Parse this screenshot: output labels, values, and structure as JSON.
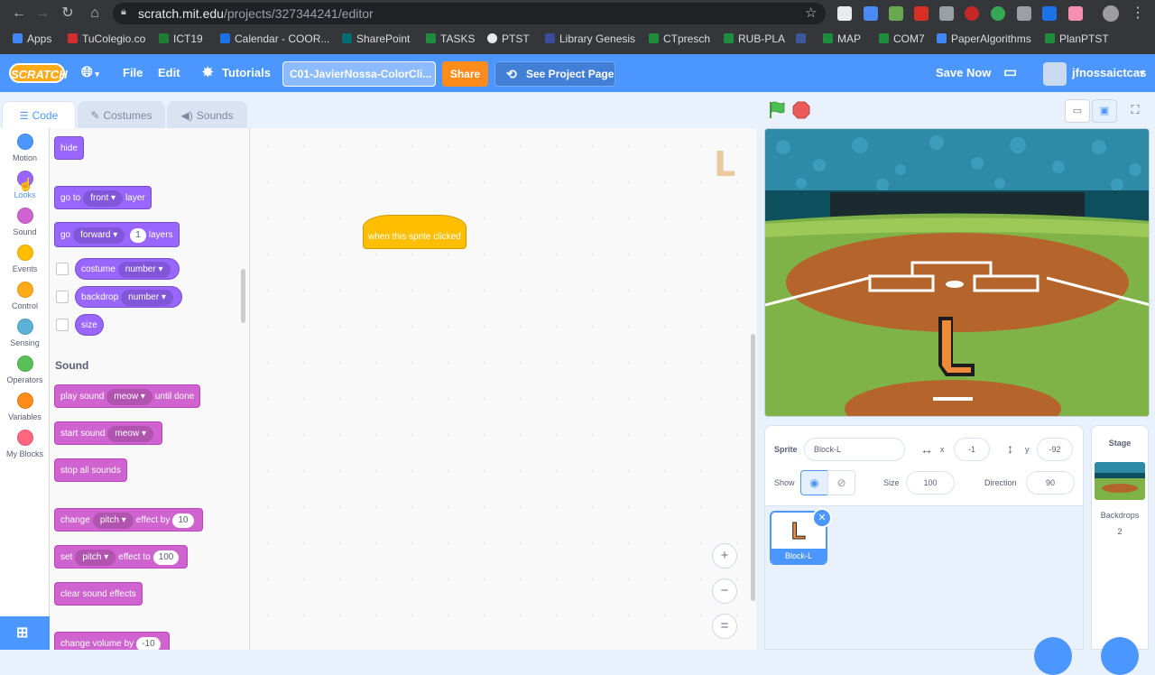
{
  "browser": {
    "url_host": "scratch.mit.edu",
    "url_path": "/projects/327344241/editor",
    "bookmarks": [
      {
        "label": "Apps",
        "color": "#4285f4"
      },
      {
        "label": "TuColegio.co",
        "color": "#d32f2f"
      },
      {
        "label": "ICT19",
        "color": "#1e7e34"
      },
      {
        "label": "Calendar - COOR...",
        "color": "#1a73e8"
      },
      {
        "label": "SharePoint",
        "color": "#036c70"
      },
      {
        "label": "TASKS",
        "color": "#1e8e3e"
      },
      {
        "label": "PTST",
        "color": "#e8eaed"
      },
      {
        "label": "Library Genesis",
        "color": "#3c4b9c"
      },
      {
        "label": "CTpresch",
        "color": "#1e8e3e"
      },
      {
        "label": "RUB-PLA",
        "color": "#1e8e3e"
      },
      {
        "label": "",
        "color": "#3b5998"
      },
      {
        "label": "MAP",
        "color": "#1e8e3e"
      },
      {
        "label": "COM7",
        "color": "#1e8e3e"
      },
      {
        "label": "PaperAlgorithms",
        "color": "#4285f4"
      },
      {
        "label": "PlanPTST",
        "color": "#1e8e3e"
      }
    ]
  },
  "menubar": {
    "logo": "SCRATCH",
    "file": "File",
    "edit": "Edit",
    "tutorials": "Tutorials",
    "project_title": "C01-JavierNossa-ColorCli...",
    "share": "Share",
    "see_project": "See Project Page",
    "save_now": "Save Now",
    "username": "jfnossaictcas"
  },
  "tabs": {
    "code": "Code",
    "costumes": "Costumes",
    "sounds": "Sounds"
  },
  "categories": [
    {
      "label": "Motion",
      "color": "#4c97ff"
    },
    {
      "label": "Looks",
      "color": "#9966ff"
    },
    {
      "label": "Sound",
      "color": "#cf63cf"
    },
    {
      "label": "Events",
      "color": "#ffbf00"
    },
    {
      "label": "Control",
      "color": "#ffab19"
    },
    {
      "label": "Sensing",
      "color": "#5cb1d6"
    },
    {
      "label": "Operators",
      "color": "#59c059"
    },
    {
      "label": "Variables",
      "color": "#ff8c1a"
    },
    {
      "label": "My Blocks",
      "color": "#ff6680"
    }
  ],
  "palette": {
    "hide": "hide",
    "goto_a": "go to",
    "goto_dd": "front",
    "goto_b": "layer",
    "go_a": "go",
    "go_dd": "forward",
    "go_num": "1",
    "go_b": "layers",
    "costume_a": "costume",
    "costume_dd": "number",
    "backdrop_a": "backdrop",
    "backdrop_dd": "number",
    "size": "size",
    "sound_heading": "Sound",
    "play_a": "play sound",
    "play_dd": "meow",
    "play_b": "until done",
    "start_a": "start sound",
    "start_dd": "meow",
    "stop_all": "stop all sounds",
    "change_a": "change",
    "change_dd": "pitch",
    "change_b": "effect by",
    "change_num": "10",
    "set_a": "set",
    "set_dd": "pitch",
    "set_b": "effect to",
    "set_num": "100",
    "clear_fx": "clear sound effects",
    "vol_a": "change volume by",
    "vol_num": "-10"
  },
  "code": {
    "hat_block": "when this sprite clicked",
    "zoom_in": "+",
    "zoom_out": "−",
    "reset": "="
  },
  "sprite_info": {
    "sprite_label": "Sprite",
    "sprite_name": "Block-L",
    "x_label": "x",
    "x_value": "-1",
    "y_label": "y",
    "y_value": "-92",
    "show_label": "Show",
    "size_label": "Size",
    "size_value": "100",
    "direction_label": "Direction",
    "direction_value": "90"
  },
  "sprite_tile": {
    "name": "Block-L"
  },
  "stage_panel": {
    "title": "Stage",
    "backdrops_label": "Backdrops",
    "backdrops_count": "2"
  }
}
